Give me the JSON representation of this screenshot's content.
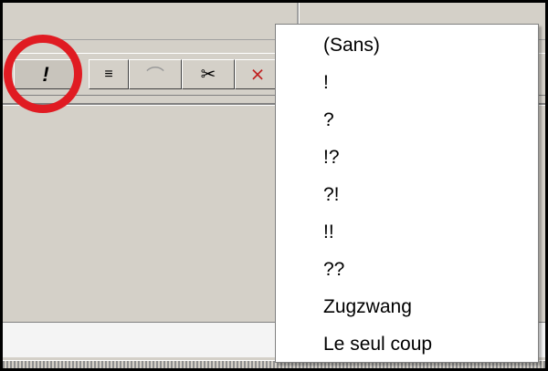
{
  "toolbar": {
    "buttons": [
      {
        "name": "annotation-button",
        "icon": "exclamation-icon",
        "glyph": "!"
      },
      {
        "name": "list-button",
        "icon": "list-lines-icon",
        "glyph": "≡"
      },
      {
        "name": "arc-button",
        "icon": "arc-icon",
        "glyph": "⌒"
      },
      {
        "name": "cut-button",
        "icon": "scissors-icon",
        "glyph": "✂"
      },
      {
        "name": "delete-move-button",
        "icon": "delete-move-icon",
        "glyph": "⨯"
      }
    ]
  },
  "annotation_menu": {
    "items": [
      "(Sans)",
      "!",
      "?",
      "!?",
      "?!",
      "!!",
      "??",
      "Zugzwang",
      "Le seul coup"
    ]
  },
  "colors": {
    "highlight_circle": "#e01b22",
    "toolbar_bg": "#d4d0c8",
    "menu_bg": "#ffffff"
  }
}
